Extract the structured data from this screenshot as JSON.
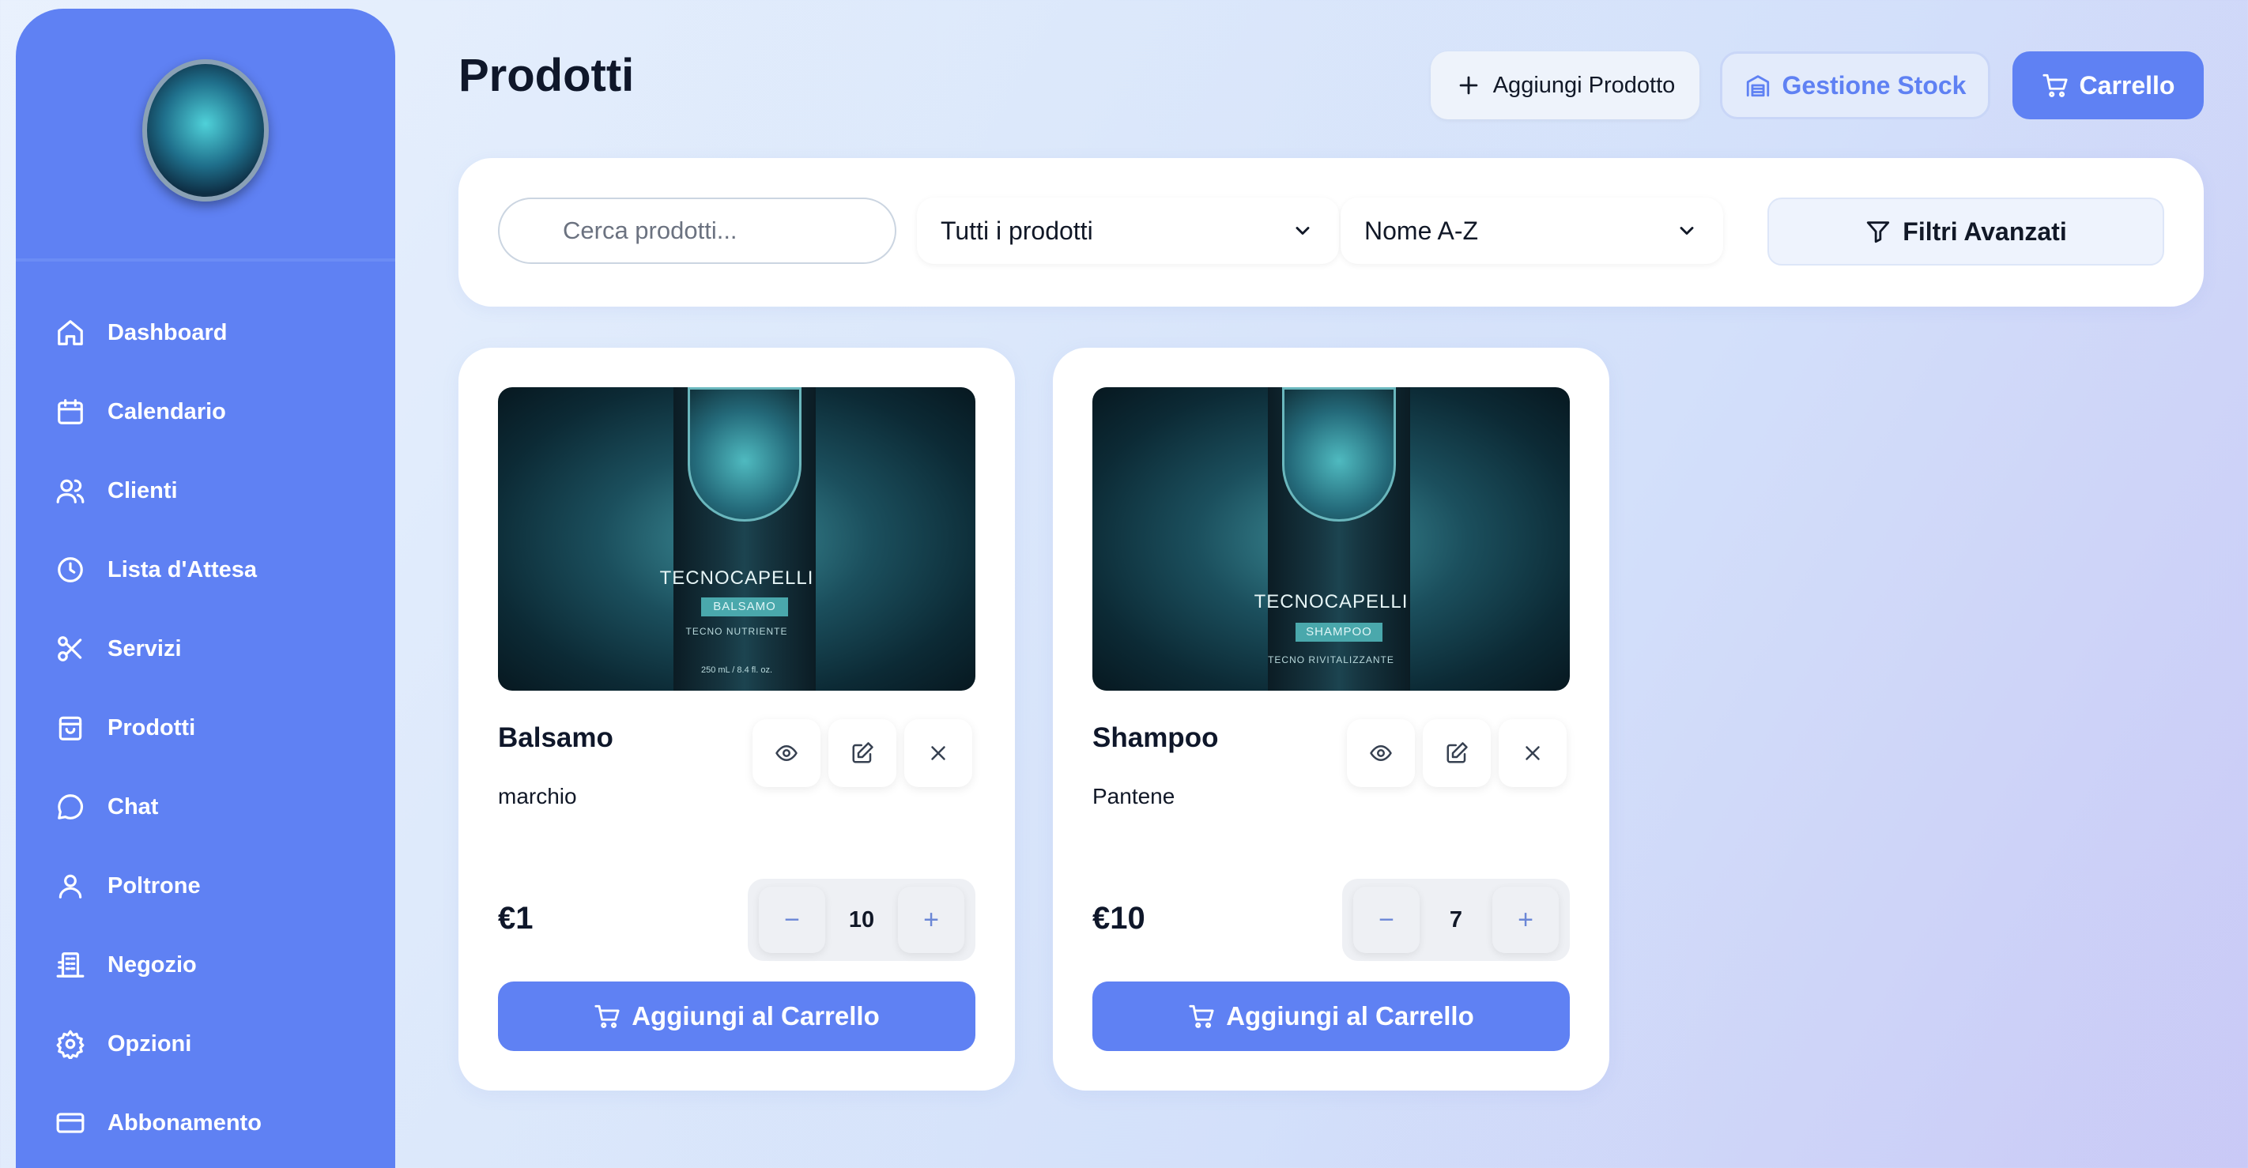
{
  "sidebar": {
    "items": [
      {
        "label": "Dashboard",
        "icon": "home-icon"
      },
      {
        "label": "Calendario",
        "icon": "calendar-icon"
      },
      {
        "label": "Clienti",
        "icon": "users-icon"
      },
      {
        "label": "Lista d'Attesa",
        "icon": "clock-icon"
      },
      {
        "label": "Servizi",
        "icon": "scissors-icon"
      },
      {
        "label": "Prodotti",
        "icon": "shopping-bag-icon"
      },
      {
        "label": "Chat",
        "icon": "chat-bubble-icon"
      },
      {
        "label": "Poltrone",
        "icon": "user-icon"
      },
      {
        "label": "Negozio",
        "icon": "building-icon"
      },
      {
        "label": "Opzioni",
        "icon": "gear-icon"
      },
      {
        "label": "Abbonamento",
        "icon": "credit-card-icon"
      }
    ]
  },
  "header": {
    "title": "Prodotti",
    "add_product_label": "Aggiungi Prodotto",
    "stock_label": "Gestione Stock",
    "cart_label": "Carrello"
  },
  "filters": {
    "search_placeholder": "Cerca prodotti...",
    "category_selected": "Tutti i prodotti",
    "sort_selected": "Nome A-Z",
    "advanced_label": "Filtri Avanzati"
  },
  "products": [
    {
      "name": "Balsamo",
      "brand": "marchio",
      "price": "€1",
      "quantity": "10",
      "add_to_cart_label": "Aggiungi al Carrello",
      "image_brand": "TECNOCAPELLI",
      "image_tag": "BALSAMO",
      "image_sub": "TECNO NUTRIENTE",
      "image_volume": "250 mL / 8.4 fl. oz."
    },
    {
      "name": "Shampoo",
      "brand": "Pantene",
      "price": "€10",
      "quantity": "7",
      "add_to_cart_label": "Aggiungi al Carrello",
      "image_brand": "TECNOCAPELLI",
      "image_tag": "SHAMPOO",
      "image_sub": "TECNO RIVITALIZZANTE"
    }
  ],
  "stepper": {
    "minus": "−",
    "plus": "+"
  },
  "colors": {
    "accent": "#5f81f3",
    "sidebar": "#5f81f3",
    "card": "#ffffff"
  }
}
